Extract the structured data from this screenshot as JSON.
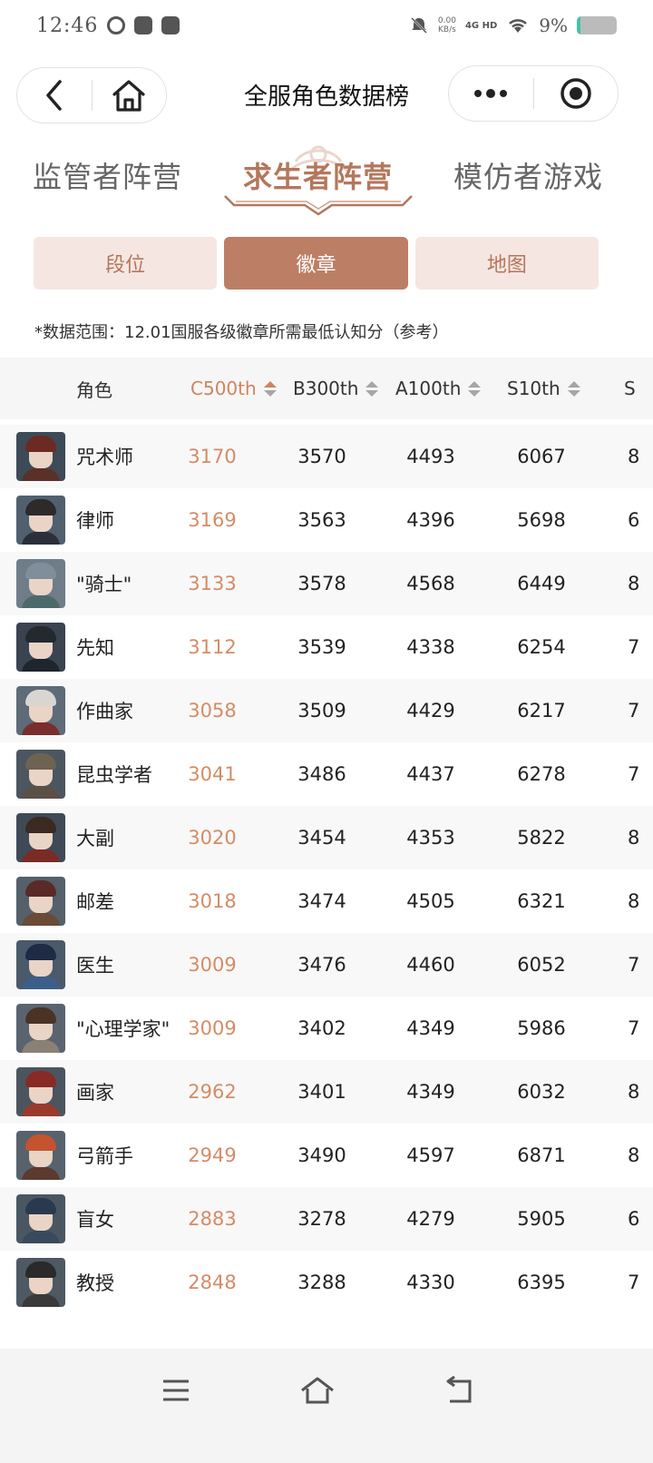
{
  "status_bar": {
    "time": "12:46",
    "net_speed_value": "0.00",
    "net_speed_unit": "KB/s",
    "network": "4G HD",
    "battery_pct": "9%",
    "battery_level": 0.09,
    "battery_color": "#41c4a8"
  },
  "header": {
    "title": "全服角色数据榜",
    "back_icon": "chevron-left-icon",
    "home_icon": "home-icon",
    "more_icon": "more-dots-icon",
    "close_icon": "target-circle-icon"
  },
  "camp_tabs": [
    {
      "label": "监管者阵营",
      "active": false
    },
    {
      "label": "求生者阵营",
      "active": true
    },
    {
      "label": "模仿者游戏",
      "active": false
    }
  ],
  "sub_tabs": [
    {
      "label": "段位",
      "active": false
    },
    {
      "label": "徽章",
      "active": true
    },
    {
      "label": "地图",
      "active": false
    }
  ],
  "note": "*数据范围：12.01国服各级徽章所需最低认知分（参考）",
  "table": {
    "headers": {
      "role": "角色",
      "c500": "C500th",
      "b300": "B300th",
      "a100": "A100th",
      "s10": "S10th",
      "s1": "S"
    },
    "sorted_column": "c500",
    "rows": [
      {
        "name": "咒术师",
        "c500": "3170",
        "b300": "3570",
        "a100": "4493",
        "s10": "6067",
        "s1": "8"
      },
      {
        "name": "律师",
        "c500": "3169",
        "b300": "3563",
        "a100": "4396",
        "s10": "5698",
        "s1": "6"
      },
      {
        "name": "\"骑士\"",
        "c500": "3133",
        "b300": "3578",
        "a100": "4568",
        "s10": "6449",
        "s1": "8"
      },
      {
        "name": "先知",
        "c500": "3112",
        "b300": "3539",
        "a100": "4338",
        "s10": "6254",
        "s1": "7"
      },
      {
        "name": "作曲家",
        "c500": "3058",
        "b300": "3509",
        "a100": "4429",
        "s10": "6217",
        "s1": "7"
      },
      {
        "name": "昆虫学者",
        "c500": "3041",
        "b300": "3486",
        "a100": "4437",
        "s10": "6278",
        "s1": "7"
      },
      {
        "name": "大副",
        "c500": "3020",
        "b300": "3454",
        "a100": "4353",
        "s10": "5822",
        "s1": "8"
      },
      {
        "name": "邮差",
        "c500": "3018",
        "b300": "3474",
        "a100": "4505",
        "s10": "6321",
        "s1": "8"
      },
      {
        "name": "医生",
        "c500": "3009",
        "b300": "3476",
        "a100": "4460",
        "s10": "6052",
        "s1": "7"
      },
      {
        "name": "\"心理学家\"",
        "c500": "3009",
        "b300": "3402",
        "a100": "4349",
        "s10": "5986",
        "s1": "7"
      },
      {
        "name": "画家",
        "c500": "2962",
        "b300": "3401",
        "a100": "4349",
        "s10": "6032",
        "s1": "8"
      },
      {
        "name": "弓箭手",
        "c500": "2949",
        "b300": "3490",
        "a100": "4597",
        "s10": "6871",
        "s1": "8"
      },
      {
        "name": "盲女",
        "c500": "2883",
        "b300": "3278",
        "a100": "4279",
        "s10": "5905",
        "s1": "6"
      },
      {
        "name": "教授",
        "c500": "2848",
        "b300": "3288",
        "a100": "4330",
        "s10": "6395",
        "s1": "7"
      }
    ]
  },
  "avatar_styles": [
    {
      "bg": "#3d4a57",
      "hair": "#6b2a22",
      "body": "#5a3128"
    },
    {
      "bg": "#51606e",
      "hair": "#2c2a2a",
      "body": "#2b2f3a"
    },
    {
      "bg": "#6f7d88",
      "hair": "#7f8e9a",
      "body": "#4d6a6a"
    },
    {
      "bg": "#3a4350",
      "hair": "#222a30",
      "body": "#1e252c"
    },
    {
      "bg": "#5e6b78",
      "hair": "#d9d6d2",
      "body": "#7a2e2e"
    },
    {
      "bg": "#4c5660",
      "hair": "#6e6252",
      "body": "#5c5046"
    },
    {
      "bg": "#3f4a56",
      "hair": "#3a2a22",
      "body": "#7a2b25"
    },
    {
      "bg": "#55606b",
      "hair": "#5a2a28",
      "body": "#6b4a36"
    },
    {
      "bg": "#4a5a6a",
      "hair": "#1f2a44",
      "body": "#3c5f8a"
    },
    {
      "bg": "#5a6470",
      "hair": "#4a3324",
      "body": "#8a8074"
    },
    {
      "bg": "#4b5560",
      "hair": "#8a2a24",
      "body": "#9a3a2c"
    },
    {
      "bg": "#57626d",
      "hair": "#c4532e",
      "body": "#5c3a2e"
    },
    {
      "bg": "#4a5763",
      "hair": "#2a3a4e",
      "body": "#3a4a5e"
    },
    {
      "bg": "#4e5964",
      "hair": "#2a2a2a",
      "body": "#3a3a3a"
    }
  ],
  "bottom_nav": {
    "menu_icon": "menu-lines-icon",
    "home_icon": "home-outline-icon",
    "back_icon": "back-arrow-icon"
  }
}
